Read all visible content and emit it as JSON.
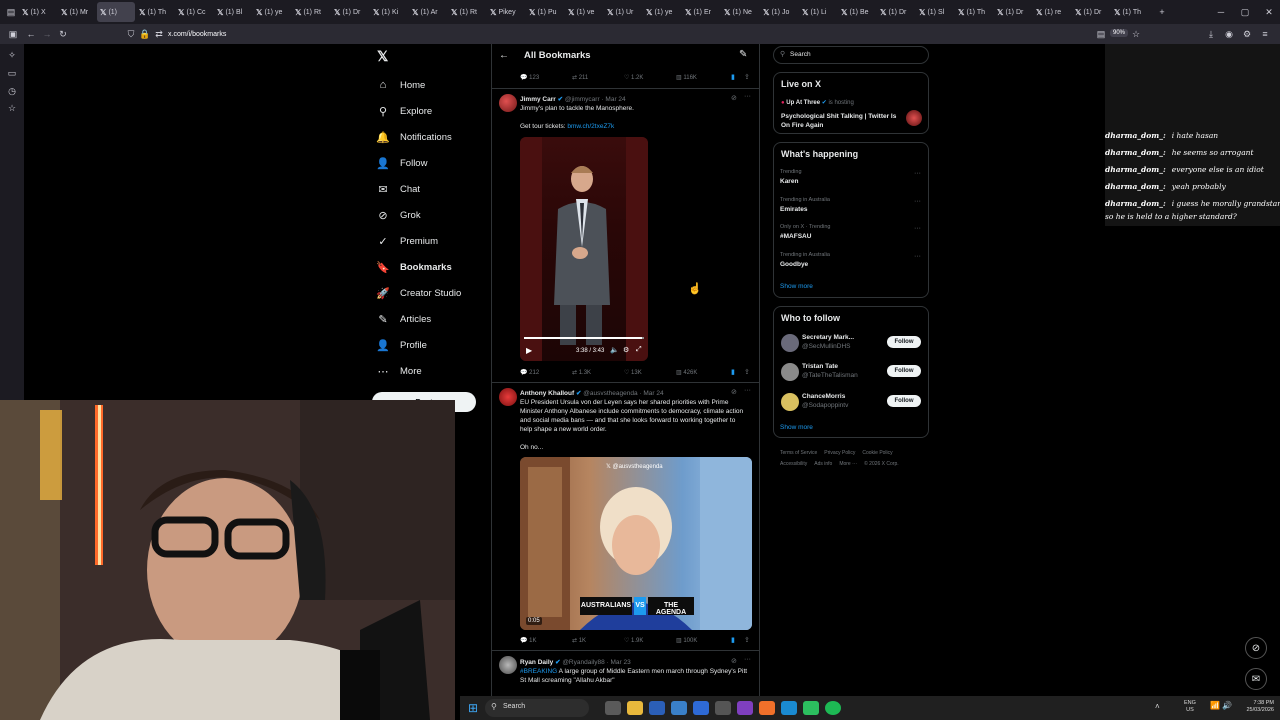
{
  "browser": {
    "tabs": [
      "(1) X",
      "(1) Mr",
      "(1)",
      "(1) Th",
      "(1) Cc",
      "(1) Bl",
      "(1) ye",
      "(1) Rt",
      "(1) Dr",
      "(1) Ki",
      "(1) Ar",
      "(1) Rt",
      "Pikey",
      "(1) Pu",
      "(1) ve",
      "(1) Ur",
      "(1) ye",
      "(1) Er",
      "(1) Ne",
      "(1) Jo",
      "(1) Li",
      "(1) Be",
      "(1) Dr",
      "(1) Sl",
      "(1) Th",
      "(1) Dr",
      "(1) re",
      "(1) Dr",
      "(1) Th"
    ],
    "active_tab_index": 2,
    "url": "x.com/i/bookmarks",
    "zoom": "90%"
  },
  "nav": {
    "logo": "𝕏",
    "items": [
      {
        "label": "Home",
        "icon": "home-icon",
        "glyph": "⌂"
      },
      {
        "label": "Explore",
        "icon": "search-icon",
        "glyph": "⚲"
      },
      {
        "label": "Notifications",
        "icon": "bell-icon",
        "glyph": "🔔"
      },
      {
        "label": "Follow",
        "icon": "person-add-icon",
        "glyph": "👤"
      },
      {
        "label": "Chat",
        "icon": "mail-icon",
        "glyph": "✉"
      },
      {
        "label": "Grok",
        "icon": "grok-icon",
        "glyph": "⊘"
      },
      {
        "label": "Premium",
        "icon": "premium-icon",
        "glyph": "✓"
      },
      {
        "label": "Bookmarks",
        "icon": "bookmark-icon",
        "glyph": "🔖"
      },
      {
        "label": "Creator Studio",
        "icon": "rocket-icon",
        "glyph": "🚀"
      },
      {
        "label": "Articles",
        "icon": "article-icon",
        "glyph": "✎"
      },
      {
        "label": "Profile",
        "icon": "profile-icon",
        "glyph": "👤"
      },
      {
        "label": "More",
        "icon": "more-icon",
        "glyph": "⋯"
      }
    ],
    "post_button": "Post"
  },
  "header": {
    "title": "All Bookmarks"
  },
  "top_stats": {
    "replies": "123",
    "reposts": "211",
    "likes": "1.2K",
    "views": "116K"
  },
  "tweets": [
    {
      "name": "Jimmy Carr",
      "handle": "@jimmycarr",
      "date": "Mar 24",
      "text": "Jimmy's plan to tackle the Manosphere.",
      "text2": "Get tour tickets: ",
      "link": "bmw.ch/2txeZ7k",
      "video_time": "3:38 / 3:43",
      "stats": {
        "replies": "212",
        "reposts": "1.3K",
        "likes": "13K",
        "views": "426K"
      }
    },
    {
      "name": "Anthony Khallouf",
      "handle": "@ausvstheagenda",
      "date": "Mar 24",
      "text": "EU President Ursula von der Leyen says her shared priorities with Prime Minister Anthony Albanese include commitments to democracy, climate action and social media bans — and that she looks forward to working together to help shape a new world order.",
      "text2": "Oh no...",
      "watermark": "𝕏 @ausvstheagenda",
      "banner_left": "AUSTRALIANS",
      "banner_mid": "VS",
      "banner_right": "THE AGENDA",
      "video_time": "0:05",
      "stats": {
        "replies": "1K",
        "reposts": "1K",
        "likes": "1.9K",
        "views": "100K"
      }
    },
    {
      "name": "Ryan Daily",
      "handle": "@Ryandaily88",
      "date": "Mar 23",
      "hashtag": "#BREAKING",
      "text": " A large group of Middle Eastern men march through Sydney's Pitt St Mall screaming \"Allahu Akbar\""
    }
  ],
  "right": {
    "search_placeholder": "Search",
    "live": {
      "title": "Live on X",
      "host": "Up At Three",
      "hosting": "is hosting",
      "space_title": "Psychological Shit Talking | Twitter Is On Fire Again"
    },
    "happening": {
      "title": "What's happening",
      "trends": [
        {
          "sub": "Trending",
          "main": "Karen"
        },
        {
          "sub": "Trending in Australia",
          "main": "Emirates"
        },
        {
          "sub": "Only on X · Trending",
          "main": "#MAFSAU"
        },
        {
          "sub": "Trending in Australia",
          "main": "Goodbye"
        }
      ],
      "show_more": "Show more"
    },
    "who_to_follow": {
      "title": "Who to follow",
      "users": [
        {
          "name": "Secretary Mark...",
          "handle": "@SecMullinDHS",
          "btn": "Follow"
        },
        {
          "name": "Tristan Tate",
          "handle": "@TateTheTalisman",
          "btn": "Follow"
        },
        {
          "name": "ChanceMorris",
          "handle": "@Sodapoppintv",
          "btn": "Follow"
        }
      ],
      "show_more": "Show more"
    },
    "footer": [
      "Terms of Service",
      "Privacy Policy",
      "Cookie Policy",
      "Accessibility",
      "Ads info",
      "More ···",
      "© 2026 X Corp."
    ]
  },
  "chat": [
    {
      "user": "dharma_dom_:",
      "msg": "i hate hasan"
    },
    {
      "user": "dharma_dom_:",
      "msg": "he seems so arrogant"
    },
    {
      "user": "dharma_dom_:",
      "msg": "everyone else is an idiot"
    },
    {
      "user": "dharma_dom_:",
      "msg": "yeah probably"
    },
    {
      "user": "dharma_dom_:",
      "msg": "i guess he morally grandstands?"
    },
    {
      "user": "",
      "msg": "so he is held to a higher standard?"
    }
  ],
  "taskbar": {
    "search": "Search",
    "lang": "ENG",
    "region": "US",
    "time": "7:38 PM",
    "date": "25/03/2026"
  },
  "colors": {
    "accent": "#1d9bf0",
    "bg": "#000000",
    "border": "#2f3336"
  }
}
